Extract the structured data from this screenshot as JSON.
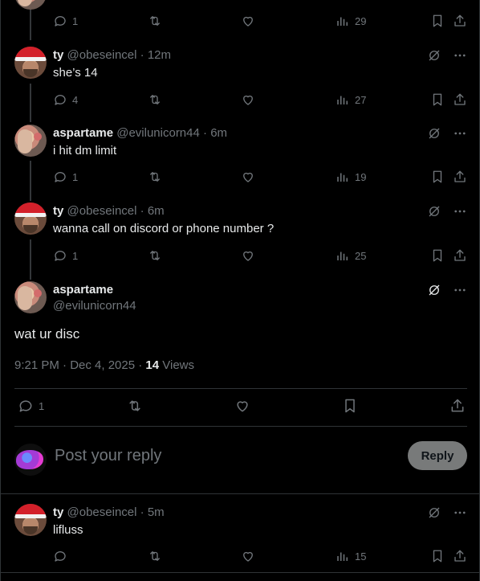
{
  "posts": [
    {
      "name": "",
      "handle": "",
      "time": "",
      "text": "",
      "replies": "1",
      "views": "29",
      "avatar": "asp"
    },
    {
      "name": "ty",
      "handle": "@obeseincel",
      "time": "12m",
      "text": "she’s 14",
      "replies": "4",
      "views": "27",
      "avatar": "ty"
    },
    {
      "name": "aspartame",
      "handle": "@evilunicorn44",
      "time": "6m",
      "text": "i hit dm limit",
      "replies": "1",
      "views": "19",
      "avatar": "asp"
    },
    {
      "name": "ty",
      "handle": "@obeseincel",
      "time": "6m",
      "text": "wanna call on discord or phone number ?",
      "replies": "1",
      "views": "25",
      "avatar": "ty"
    }
  ],
  "main_post": {
    "name": "aspartame",
    "handle": "@evilunicorn44",
    "text": "wat ur disc",
    "timestamp": "9:21 PM · Dec 4, 2025 · ",
    "views_count": "14",
    "views_label": " Views",
    "replies": "1"
  },
  "compose": {
    "placeholder": "Post your reply",
    "reply_label": "Reply"
  },
  "last_post": {
    "name": "ty",
    "handle": "@obeseincel",
    "time": "5m",
    "text": "lifluss",
    "views": "15"
  },
  "sep": " · ",
  "colors": {
    "background": "#000000",
    "muted": "#71767b",
    "text": "#e7e9ea",
    "reply_button": "#787a7a"
  },
  "icons": [
    "reply-icon",
    "retweet-icon",
    "like-icon",
    "views-icon",
    "bookmark-icon",
    "share-icon",
    "grok-icon",
    "more-icon"
  ]
}
